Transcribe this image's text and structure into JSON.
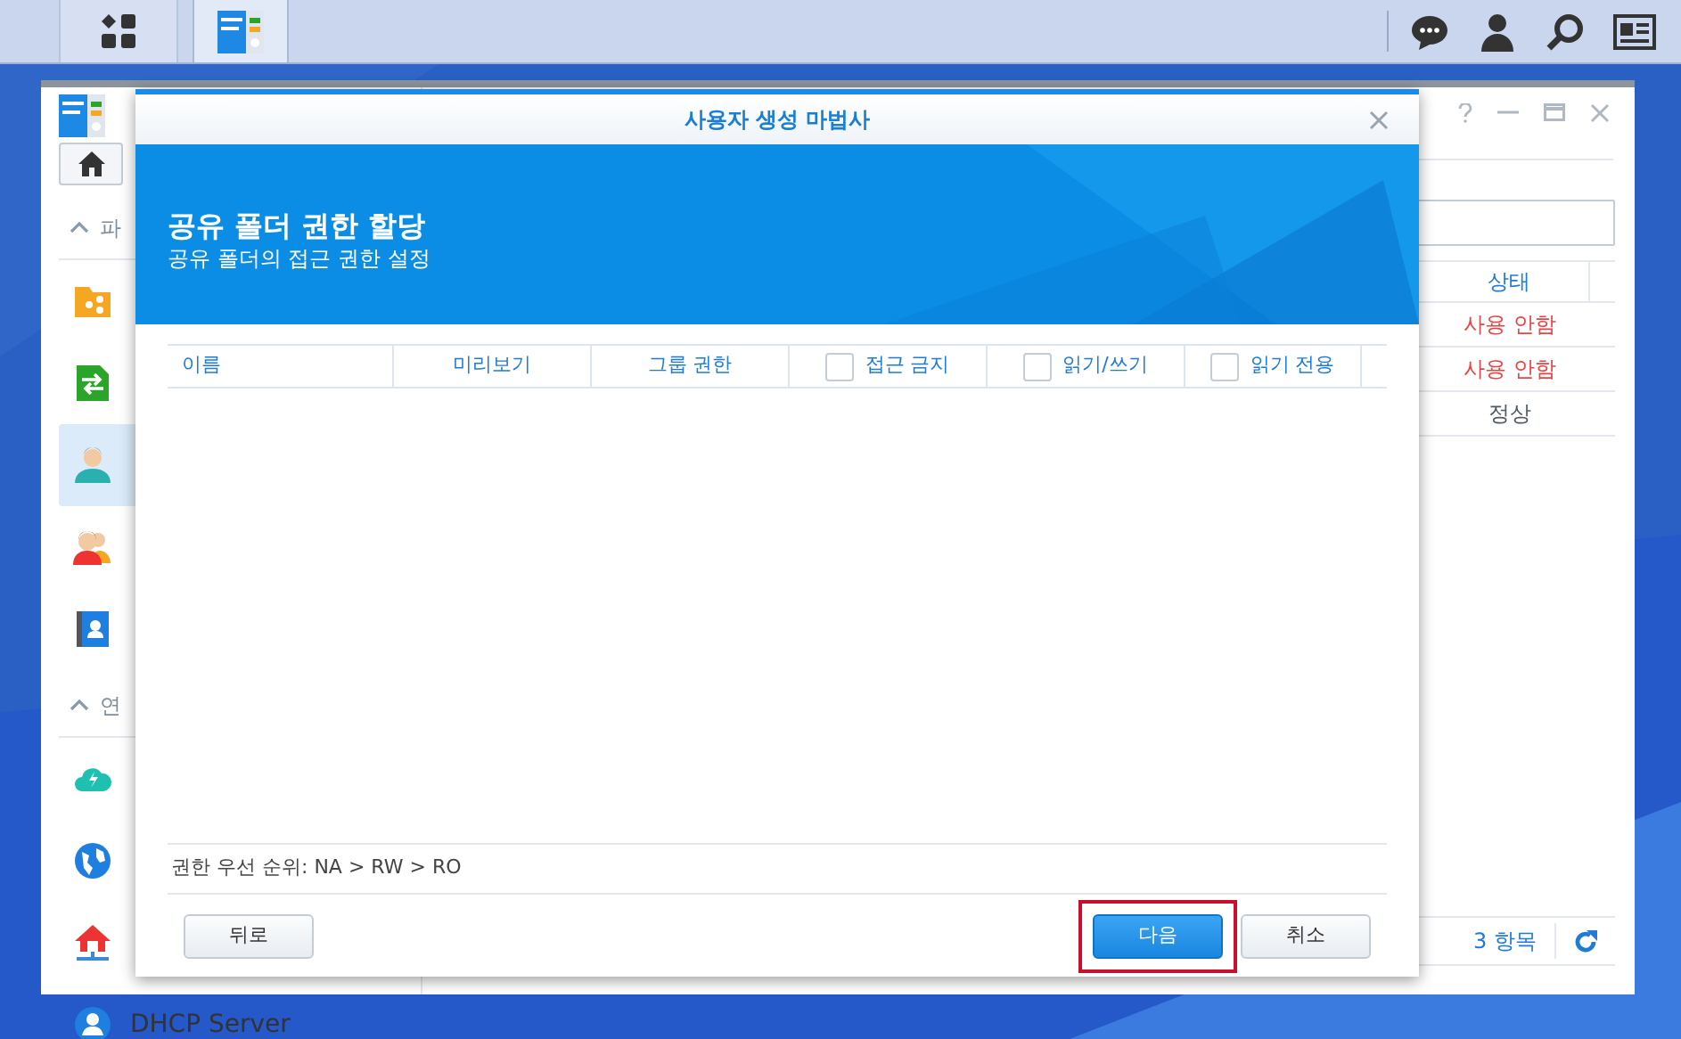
{
  "taskbar": {
    "buttons": [
      {
        "kind": "menu",
        "selected": false
      },
      {
        "kind": "app",
        "selected": true
      }
    ]
  },
  "background_window": {
    "sidebar": {
      "items": [
        {
          "kind": "header",
          "label": "파"
        },
        {
          "kind": "item",
          "selected": false
        },
        {
          "kind": "item",
          "selected": false
        },
        {
          "kind": "item",
          "selected": true
        },
        {
          "kind": "item",
          "selected": false
        },
        {
          "kind": "item",
          "selected": false
        },
        {
          "kind": "header",
          "label": "연"
        },
        {
          "kind": "item",
          "selected": false
        },
        {
          "kind": "item",
          "selected": false
        },
        {
          "kind": "item",
          "selected": false
        },
        {
          "kind": "item",
          "label": "DHCP Server",
          "selected": false
        }
      ]
    },
    "table": {
      "columns": [
        "상태"
      ],
      "rows": [
        {
          "status": "사용 안함",
          "color": "#e64545"
        },
        {
          "status": "사용 안함",
          "color": "#e64545"
        },
        {
          "status": "정상",
          "color": "#505a64"
        }
      ]
    },
    "footer": {
      "count": "3 항목"
    }
  },
  "dialog": {
    "title": "사용자 생성 마법사",
    "heading": "공유 폴더 권한 할당",
    "subheading": "공유 폴더의 접근 권한 설정",
    "columns": [
      {
        "kind": "text",
        "label": "이름"
      },
      {
        "kind": "text",
        "label": "미리보기"
      },
      {
        "kind": "text",
        "label": "그룹 권한"
      },
      {
        "kind": "checkbox",
        "label": "접근 금지",
        "checked": false
      },
      {
        "kind": "checkbox",
        "label": "읽기/쓰기",
        "checked": false
      },
      {
        "kind": "checkbox",
        "label": "읽기 전용",
        "checked": false
      }
    ],
    "note": "권한 우선 순위: NA > RW > RO",
    "buttons": [
      {
        "label": "뒤로",
        "kind": "secondary",
        "highlighted": false
      },
      {
        "label": "다음",
        "kind": "primary",
        "highlighted": true
      },
      {
        "label": "취소",
        "kind": "secondary",
        "highlighted": false
      }
    ]
  }
}
